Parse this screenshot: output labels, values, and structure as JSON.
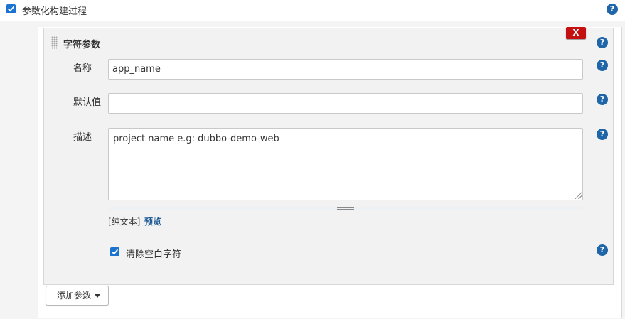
{
  "top": {
    "checkbox_checked": true,
    "label": "参数化构建过程"
  },
  "param_block": {
    "title": "字符参数",
    "close_label": "X",
    "name_field": {
      "label": "名称",
      "value": "app_name"
    },
    "default_field": {
      "label": "默认值",
      "value": ""
    },
    "description_field": {
      "label": "描述",
      "value": "project name e.g: dubbo-demo-web"
    },
    "format": {
      "plain_text": "[纯文本]",
      "preview": "预览"
    },
    "trim": {
      "checked": true,
      "label": "清除空白字符"
    }
  },
  "add_button": {
    "label": "添加参数"
  },
  "help_label": "?",
  "colors": {
    "help_blue": "#1f66a8",
    "close_red": "#c41010",
    "checkbox_blue": "#1a73d1",
    "link_blue": "#1f5b95"
  }
}
